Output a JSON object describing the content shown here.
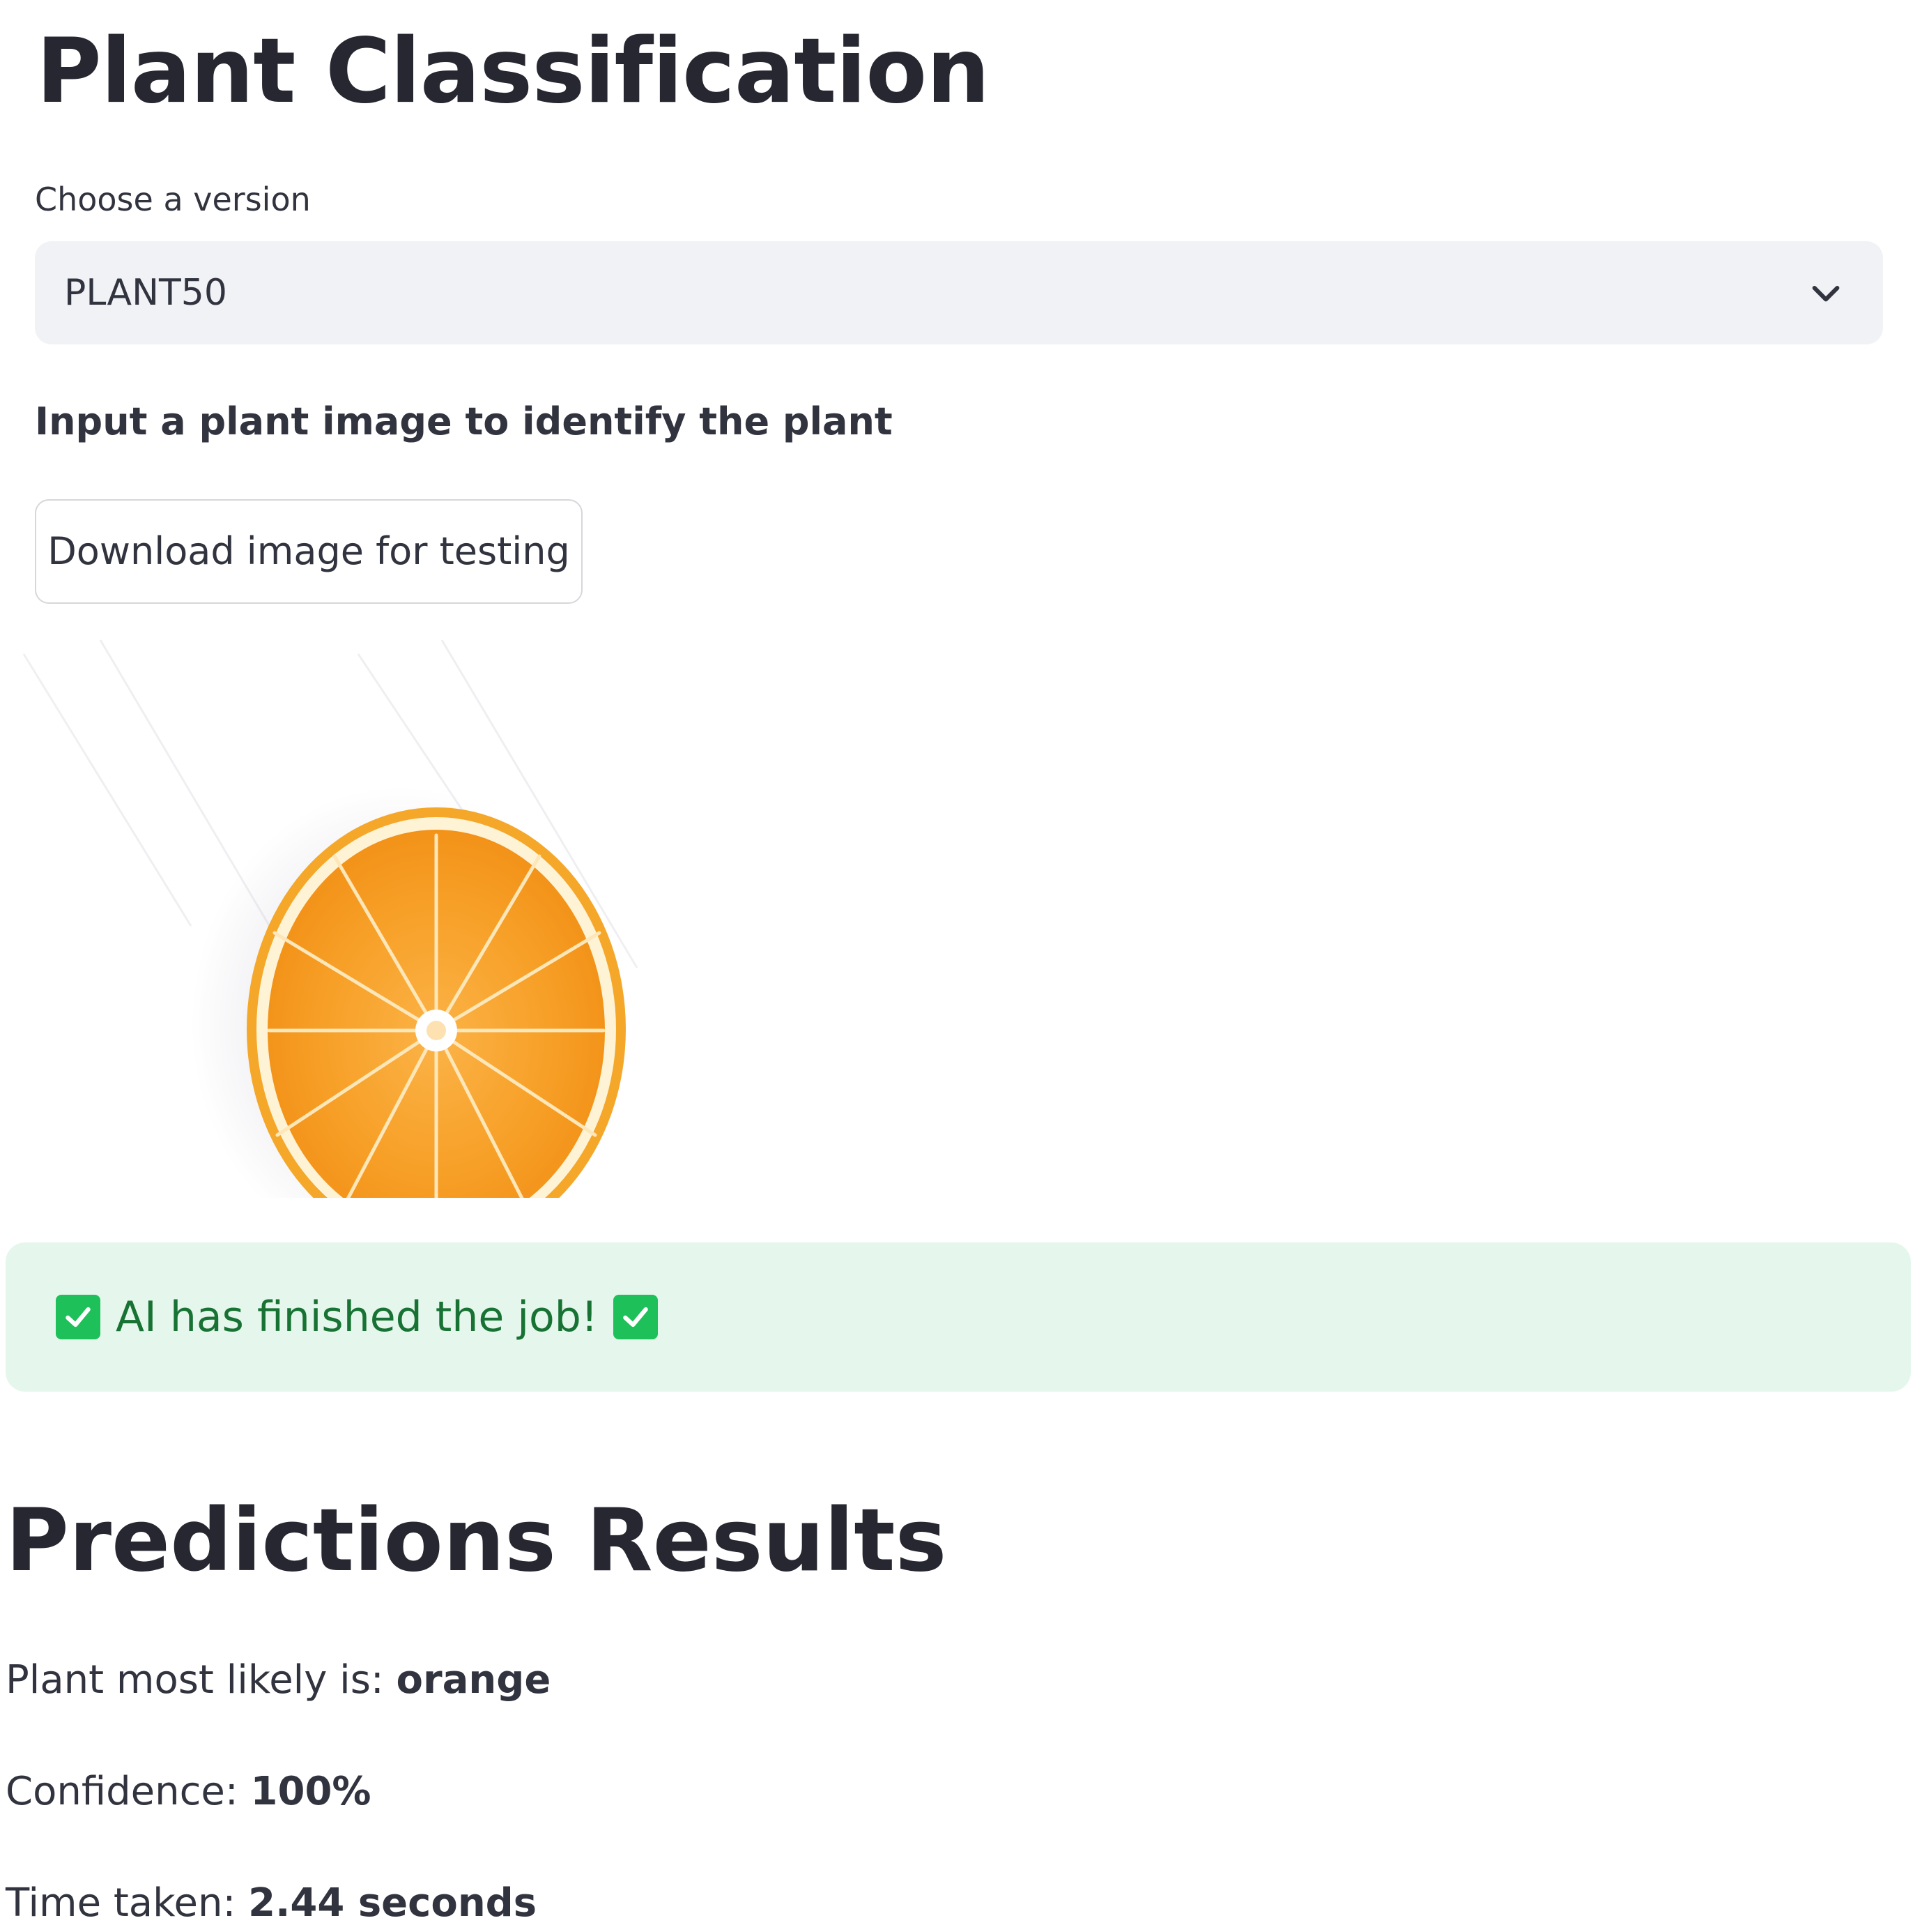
{
  "page": {
    "title": "Plant Classification"
  },
  "version_select": {
    "label": "Choose a version",
    "value": "PLANT50"
  },
  "input_section": {
    "label": "Input a plant image to identify the plant",
    "download_button": "Download image for testing"
  },
  "image": {
    "subject": "orange slice photo",
    "icon": "orange-slice"
  },
  "status": {
    "message": "AI has finished the job!",
    "icon": "check-box-icon",
    "color": "#1ec05a",
    "background": "#e5f7ec"
  },
  "results": {
    "title": "Predictions Results",
    "plant_label": "Plant most likely is:",
    "plant_value": "orange",
    "confidence_label": "Confidence:",
    "confidence_value": "100%",
    "time_label": "Time taken:",
    "time_value": "2.44 seconds"
  }
}
